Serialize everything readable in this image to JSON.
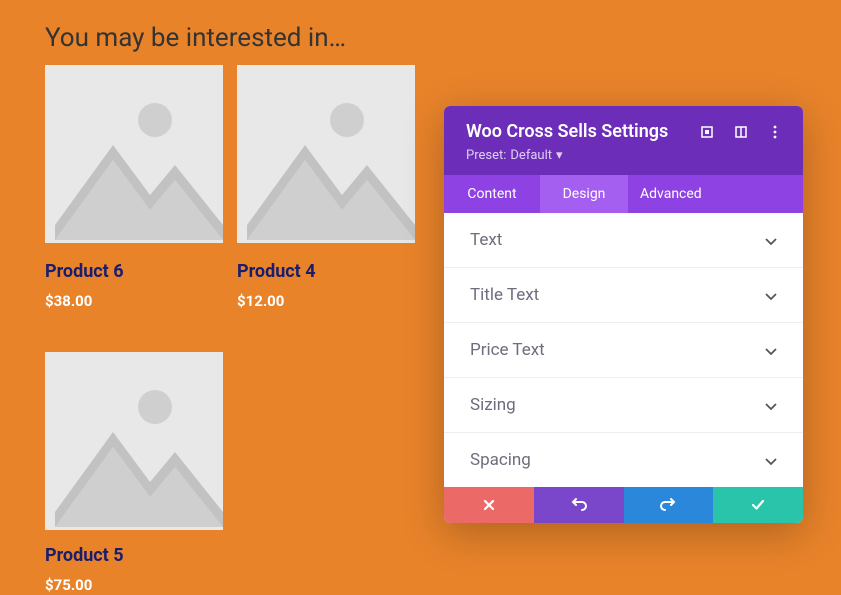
{
  "section_title": "You may be interested in…",
  "products": [
    {
      "title": "Product 6",
      "price": "$38.00"
    },
    {
      "title": "Product 4",
      "price": "$12.00"
    },
    {
      "title": "Product 5",
      "price": "$75.00"
    }
  ],
  "panel": {
    "title": "Woo Cross Sells Settings",
    "preset_label": "Preset:",
    "preset_value": "Default",
    "tabs": {
      "content": "Content",
      "design": "Design",
      "advanced": "Advanced"
    },
    "accordion": [
      "Text",
      "Title Text",
      "Price Text",
      "Sizing",
      "Spacing"
    ]
  }
}
